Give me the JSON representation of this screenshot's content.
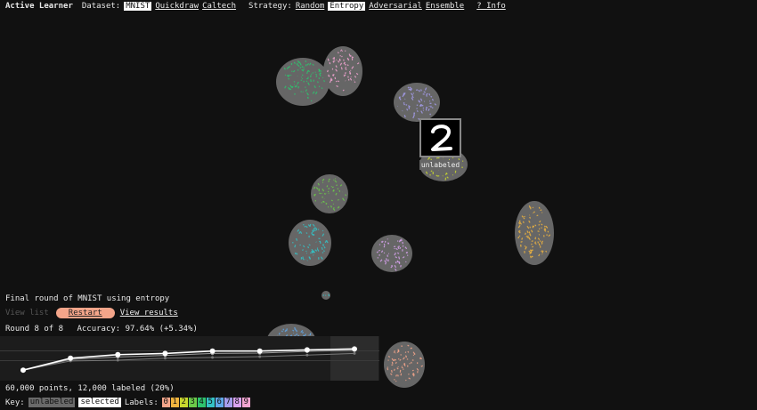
{
  "app": {
    "title": "Active Learner"
  },
  "nav": {
    "dataset_label": "Dataset:",
    "datasets": [
      {
        "label": "MNIST",
        "active": true
      },
      {
        "label": "Quickdraw",
        "active": false
      },
      {
        "label": "Caltech",
        "active": false
      }
    ],
    "strategy_label": "Strategy:",
    "strategies": [
      {
        "label": "Random",
        "active": false
      },
      {
        "label": "Entropy",
        "active": true
      },
      {
        "label": "Adversarial",
        "active": false
      },
      {
        "label": "Ensemble",
        "active": false
      }
    ],
    "info_label": "? Info"
  },
  "tooltip": {
    "digit": "2",
    "caption": "unlabeled"
  },
  "panel": {
    "title": "Final round of MNIST using entropy",
    "view_list": "View list",
    "restart": "Restart",
    "view_results": "View results",
    "round_text": "Round 8 of 8",
    "accuracy_text": "Accuracy: 97.64% (+5.34%)",
    "points_text": "60,000 points, 12,000 labeled (20%)"
  },
  "accuracy_chart": {
    "type": "line",
    "x": [
      1,
      2,
      3,
      4,
      5,
      6,
      7,
      8
    ],
    "series": [
      {
        "values": [
          92.3,
          95.3,
          96.2,
          96.5,
          97.1,
          97.1,
          97.4,
          97.64
        ]
      },
      {
        "values": [
          92.3,
          95.0,
          95.6,
          96.0,
          96.5,
          96.6,
          97.0,
          97.3
        ]
      },
      {
        "values": [
          92.3,
          94.6,
          94.8,
          95.3,
          95.5,
          95.7,
          96.1,
          96.5
        ]
      }
    ],
    "ylim": [
      91,
      99.5
    ],
    "current_round": 8
  },
  "key": {
    "label": "Key:",
    "unlabeled": "unlabeled",
    "selected": "selected",
    "labels_label": "Labels:",
    "labels": [
      "0",
      "1",
      "2",
      "3",
      "4",
      "5",
      "6",
      "7",
      "8",
      "9"
    ]
  },
  "colors": {
    "class_colors": [
      "#f4a58a",
      "#f1b53f",
      "#c9d82e",
      "#6ccb4a",
      "#2ec36e",
      "#34c2c6",
      "#60a7e8",
      "#a59ded",
      "#d9a3f0",
      "#f2a4d1"
    ],
    "unlabeled": "#666666",
    "accent": "#f4a58a"
  }
}
